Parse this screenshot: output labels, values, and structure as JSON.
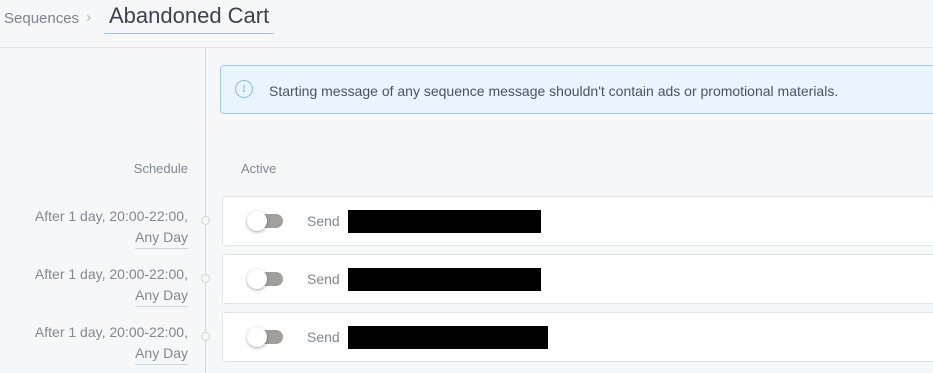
{
  "breadcrumb": {
    "parent": "Sequences",
    "separator": "›",
    "title": "Abandoned Cart"
  },
  "notice": {
    "icon": "info-icon",
    "text": "Starting message of any sequence message shouldn't contain ads or promotional materials."
  },
  "columns": {
    "schedule": "Schedule",
    "active": "Active"
  },
  "rows": [
    {
      "schedule_line1": "After 1 day, 20:00-22:00,",
      "schedule_line2": "Any Day",
      "send_label": "Send",
      "active": false
    },
    {
      "schedule_line1": "After 1 day, 20:00-22:00,",
      "schedule_line2": "Any Day",
      "send_label": "Send",
      "active": false
    },
    {
      "schedule_line1": "After 1 day, 20:00-22:00,",
      "schedule_line2": "Any Day",
      "send_label": "Send",
      "active": false
    }
  ],
  "colors": {
    "accent_border": "#9fc9ef",
    "notice_bg": "#eaf4fe",
    "toggle_off": "#a39e9e",
    "redaction": "#000000"
  }
}
